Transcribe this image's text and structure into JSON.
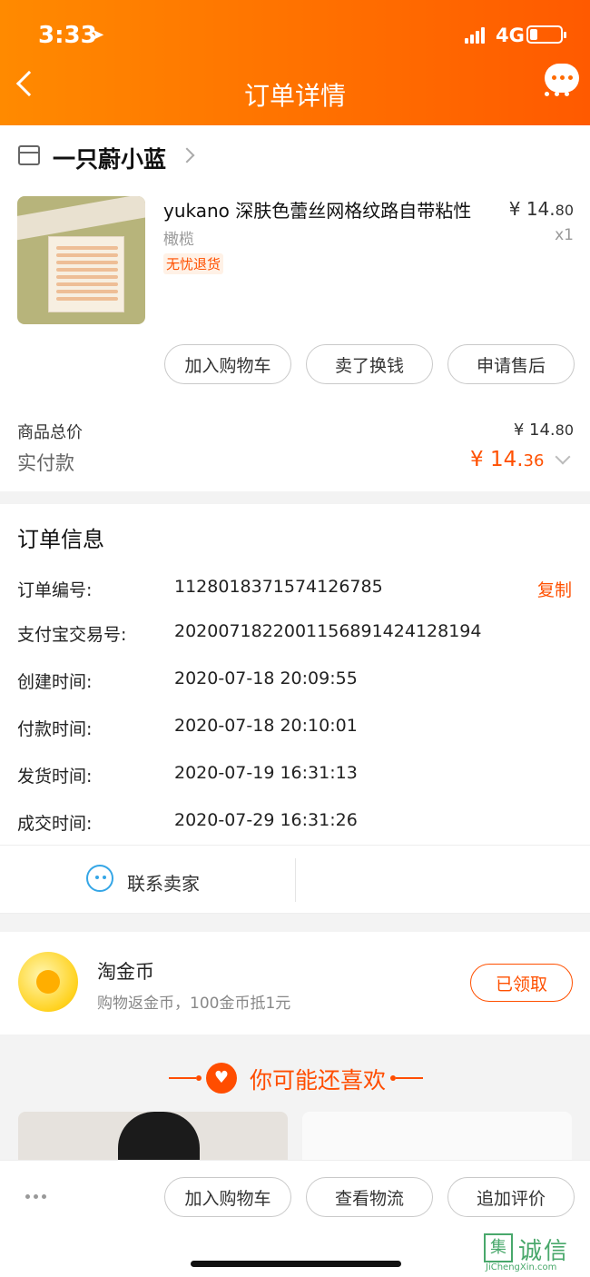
{
  "status_bar": {
    "time": "3:33",
    "network": "4G"
  },
  "nav": {
    "title": "订单详情"
  },
  "shop": {
    "name": "一只蔚小蓝"
  },
  "product": {
    "name": "yukano 深肤色蕾丝网格纹路自带粘性",
    "sku": "橄榄",
    "tag": "无忧退货",
    "price_int": "¥ 14.",
    "price_dec": "80",
    "qty": "x1"
  },
  "item_actions": [
    "加入购物车",
    "卖了换钱",
    "申请售后"
  ],
  "totals": {
    "goods_label": "商品总价",
    "goods_int": "¥ 14.",
    "goods_dec": "80",
    "paid_label": "实付款",
    "paid_int": "¥ 14.",
    "paid_dec": "36"
  },
  "order_info": {
    "title": "订单信息",
    "copy_label": "复制",
    "rows": [
      {
        "label": "订单编号:",
        "value": "1128018371574126785"
      },
      {
        "label": "支付宝交易号:",
        "value": "2020071822001156891424128194"
      },
      {
        "label": "创建时间:",
        "value": "2020-07-18 20:09:55"
      },
      {
        "label": "付款时间:",
        "value": "2020-07-18 20:10:01"
      },
      {
        "label": "发货时间:",
        "value": "2020-07-19 16:31:13"
      },
      {
        "label": "成交时间:",
        "value": "2020-07-29 16:31:26"
      }
    ]
  },
  "contact": {
    "label": "联系卖家"
  },
  "coins": {
    "title": "淘金币",
    "desc": "购物返金币，100金币抵1元",
    "button": "已领取"
  },
  "recommend": {
    "title": "你可能还喜欢"
  },
  "bottom_actions": [
    "加入购物车",
    "查看物流",
    "追加评价"
  ],
  "watermark": {
    "mark": "集",
    "text": "诚信",
    "url": "JiChengXin.com"
  },
  "colors": {
    "accent": "#ff5000",
    "header_from": "#ff8a00",
    "header_to": "#ff5a00",
    "contact_icon": "#35a6e6"
  }
}
